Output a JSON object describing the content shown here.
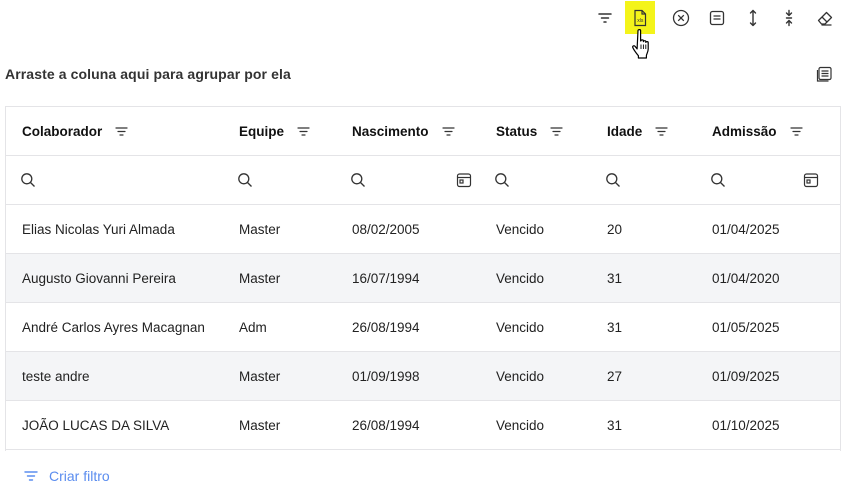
{
  "toolbar": {
    "buttons": [
      {
        "name": "filter-icon"
      },
      {
        "name": "export-xls-icon",
        "label": "xls"
      },
      {
        "name": "clear-icon"
      },
      {
        "name": "column-chooser-icon"
      },
      {
        "name": "expand-icon"
      },
      {
        "name": "collapse-icon"
      },
      {
        "name": "eraser-icon"
      }
    ]
  },
  "group_panel": {
    "hint": "Arraste a coluna aqui para agrupar por ela"
  },
  "grid": {
    "columns": [
      "Colaborador",
      "Equipe",
      "Nascimento",
      "Status",
      "Idade",
      "Admissão"
    ],
    "rows": [
      [
        "Elias Nicolas Yuri Almada",
        "Master",
        "08/02/2005",
        "Vencido",
        "20",
        "01/04/2025"
      ],
      [
        "Augusto Giovanni Pereira",
        "Master",
        "16/07/1994",
        "Vencido",
        "31",
        "01/04/2020"
      ],
      [
        "André Carlos Ayres Macagnan",
        "Adm",
        "26/08/1994",
        "Vencido",
        "31",
        "01/05/2025"
      ],
      [
        "teste andre",
        "Master",
        "01/09/1998",
        "Vencido",
        "27",
        "01/09/2025"
      ],
      [
        "JOÃO LUCAS DA SILVA",
        "Master",
        "26/08/1994",
        "Vencido",
        "31",
        "01/10/2025"
      ]
    ]
  },
  "footer": {
    "create_filter_label": "Criar filtro"
  },
  "colors": {
    "highlight": "#f4f41a",
    "link": "#5b8def",
    "zebra": "#f4f5f7",
    "border": "#e4e4e7"
  }
}
